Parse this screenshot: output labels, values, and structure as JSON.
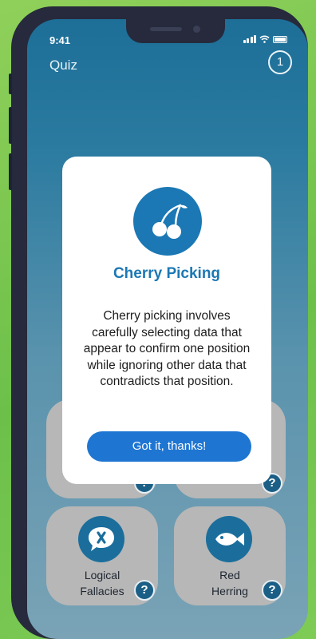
{
  "status": {
    "time": "9:41"
  },
  "header": {
    "title": "Quiz",
    "question_counter": "1"
  },
  "cards": [
    {
      "label": "",
      "icon": "unknown-icon",
      "help": "?"
    },
    {
      "label": "",
      "icon": "unknown-icon",
      "help": "?"
    },
    {
      "label_line1": "Logical",
      "label_line2": "Fallacies",
      "icon": "speech-bubble-x-icon",
      "help": "?"
    },
    {
      "label_line1": "Red",
      "label_line2": "Herring",
      "icon": "fish-icon",
      "help": "?"
    }
  ],
  "modal": {
    "icon": "cherry-icon",
    "title": "Cherry Picking",
    "body": "Cherry picking involves carefully selecting data that appear to confirm one position while ignoring other data that contradicts that position.",
    "button": "Got it, thanks!"
  },
  "colors": {
    "background": "#7ecb56",
    "phone_frame": "#262a3c",
    "accent": "#1b78b4",
    "button": "#1f76d2",
    "card": "#b7b7b7"
  }
}
